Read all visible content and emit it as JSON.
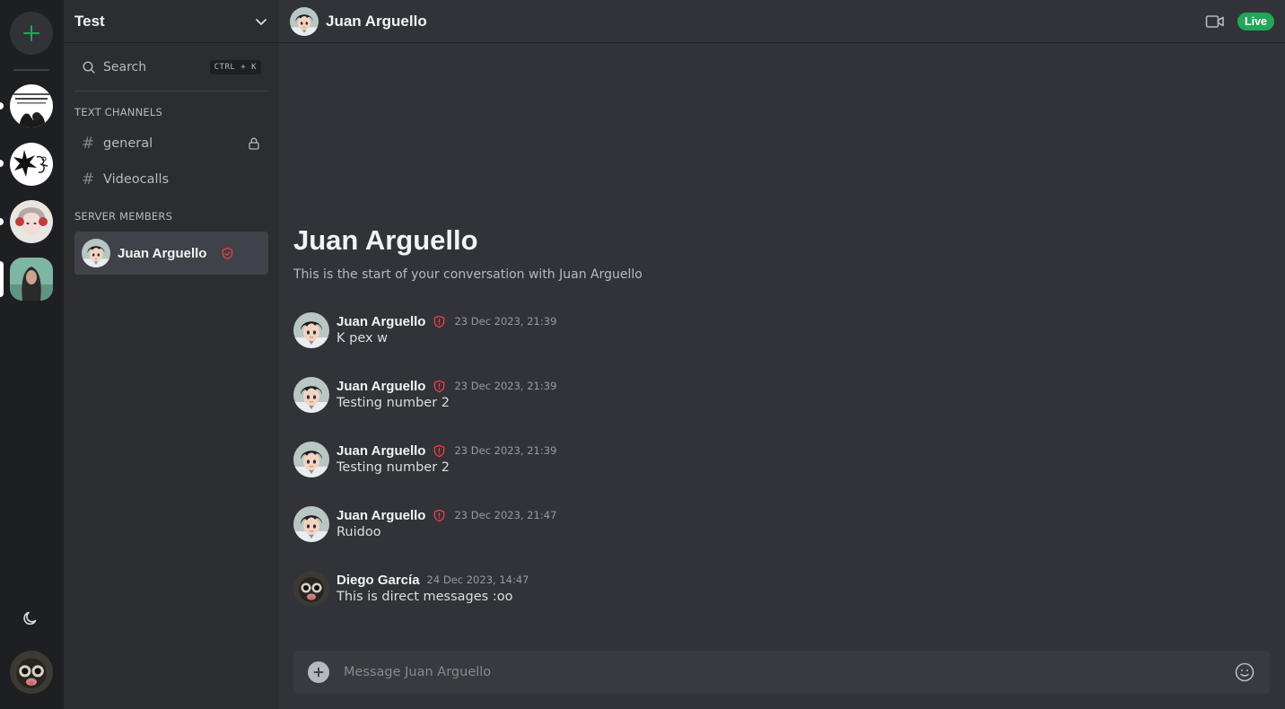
{
  "colors": {
    "accent_green": "#23a55a",
    "moderator_shield": "#f23f43",
    "background": "#313338",
    "sidebar": "#2b2d31",
    "rail": "#1e1f22"
  },
  "rail": {
    "add_server_icon": "plus-icon",
    "servers": [
      {
        "name": "server-1",
        "avatar": "server-icon-1"
      },
      {
        "name": "server-2",
        "avatar": "server-icon-2"
      },
      {
        "name": "server-3",
        "avatar": "server-icon-3"
      },
      {
        "name": "server-4",
        "avatar": "server-icon-4",
        "selected": true
      }
    ],
    "theme_icon": "moon-icon"
  },
  "sidebar": {
    "server_name": "Test",
    "search_label": "Search",
    "search_shortcut": "CTRL + K",
    "text_channels_label": "TEXT CHANNELS",
    "channels": [
      {
        "name": "general",
        "locked": true
      },
      {
        "name": "Videocalls",
        "locked": false
      }
    ],
    "members_label": "SERVER MEMBERS",
    "members": [
      {
        "name": "Juan Arguello",
        "role_icon": "shield-check-icon"
      }
    ]
  },
  "header": {
    "title": "Juan Arguello",
    "live_label": "Live"
  },
  "conversation": {
    "welcome_title": "Juan Arguello",
    "welcome_subtitle": "This is the start of your conversation with Juan Arguello"
  },
  "messages": [
    {
      "author": "Juan Arguello",
      "timestamp": "23 Dec 2023, 21:39",
      "text": "K pex w",
      "role_icon": "shield-alert-icon"
    },
    {
      "author": "Juan Arguello",
      "timestamp": "23 Dec 2023, 21:39",
      "text": "Testing number 2",
      "role_icon": "shield-alert-icon"
    },
    {
      "author": "Juan Arguello",
      "timestamp": "23 Dec 2023, 21:39",
      "text": "Testing number 2",
      "role_icon": "shield-alert-icon"
    },
    {
      "author": "Juan Arguello",
      "timestamp": "23 Dec 2023, 21:47",
      "text": "Ruidoo",
      "role_icon": "shield-alert-icon"
    },
    {
      "author": "Diego García",
      "timestamp": "24 Dec 2023, 14:47",
      "text": "This is direct messages :oo",
      "role_icon": ""
    }
  ],
  "composer": {
    "placeholder": "Message Juan Arguello"
  }
}
